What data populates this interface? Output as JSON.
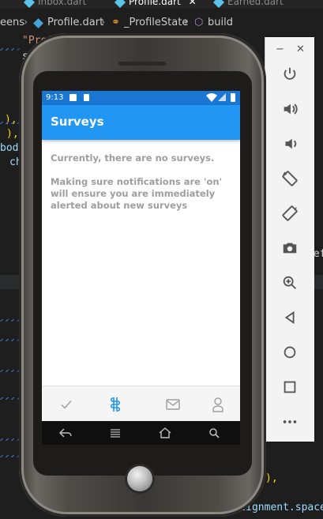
{
  "editor": {
    "tabs": [
      "Inbox.dart",
      "Profile.dart",
      "Earned.dart"
    ],
    "tab_close_glyph": "✕",
    "breadcrumb": {
      "folder": "eens",
      "file": "Profile.dart",
      "class": "_ProfileState",
      "method": "build"
    },
    "code_fragments": [
      "\"Profil",
      "s",
      "),",
      "), ",
      "body",
      "ch",
      "cef",
      "\"",
      "l",
      ")",
      "),",
      "xisAlignment.space"
    ]
  },
  "emulator_toolbar": {
    "minimize_glyph": "−",
    "close_glyph": "✕",
    "buttons": [
      "power",
      "volume-up",
      "volume-down",
      "rotate-left",
      "rotate-right",
      "screenshot",
      "zoom",
      "back",
      "home",
      "overview",
      "more"
    ]
  },
  "phone": {
    "status": {
      "time": "9:13"
    },
    "app": {
      "title": "Surveys",
      "message_line1": "Currently, there are no surveys.",
      "message_line2": "Making sure notifications are 'on' will ensure you are immediately alerted about new surveys"
    },
    "bottom_nav": {
      "items": [
        "check",
        "survey",
        "mail",
        "profile"
      ],
      "active_index": 1
    },
    "colors": {
      "appbar": "#2196f3",
      "statusbar": "#1976d2",
      "active_nav": "#2196f3",
      "inactive_nav": "#9e9e9e"
    }
  }
}
